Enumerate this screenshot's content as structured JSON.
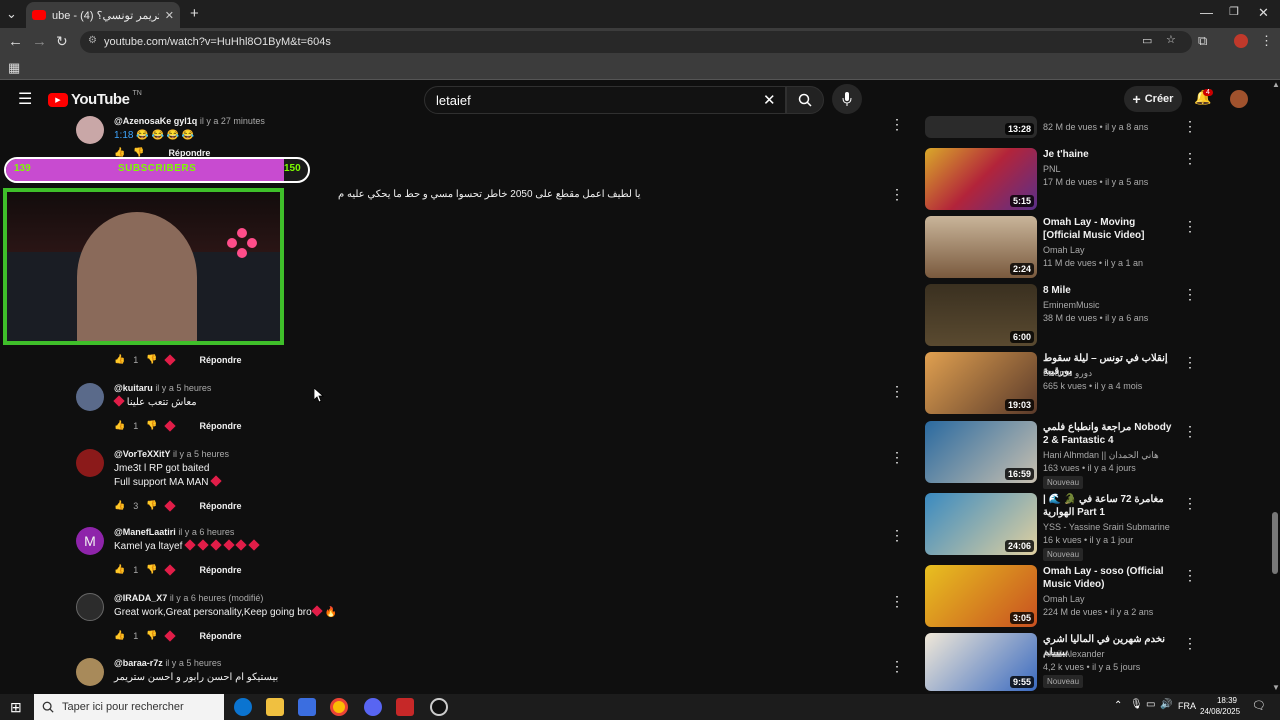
{
  "browser": {
    "tab_title": "ube - (4) أحسن ستريمر تونسي؟",
    "url": "youtube.com/watch?v=HuHhl8O1ByM&t=604s"
  },
  "header": {
    "logo": "YouTube",
    "region": "TN",
    "search_value": "letaief",
    "create_label": "Créer",
    "notif_count": "4"
  },
  "overlay": {
    "sub_left": "139",
    "sub_label": "SUBSCRIBERS",
    "sub_right": "150",
    "sub_progress": 0.92
  },
  "comments": {
    "reply_label": "Répondre",
    "items": [
      {
        "author": "@AzenosaKe gyl1q",
        "time": "il y a 27 minutes",
        "text": "1:18 😂 😂 😂 😂",
        "likes": ""
      },
      {
        "author": "",
        "time": "",
        "text": "يا لطيف اعمل مقطع على 2050 خاطر تحسوا مسي و حط ما يحكي عليه م",
        "likes": "1"
      },
      {
        "author": "@kuitaru",
        "time": "il y a 5 heures",
        "text": "معاش تتعب علينا",
        "likes": "1"
      },
      {
        "author": "@VorTeXXitY",
        "time": "il y a 5 heures",
        "text": "Jme3t l RP got baited",
        "text2": "Full support MA MAN",
        "likes": "3"
      },
      {
        "author": "@ManefLaatiri",
        "time": "il y a 6 heures",
        "text": "Kamel ya ltayef",
        "likes": "1"
      },
      {
        "author": "@IRADA_X7",
        "time": "il y a 6 heures (modifié)",
        "text": "Great work,Great personality,Keep going bro",
        "likes": "1"
      },
      {
        "author": "@baraa-r7z",
        "time": "il y a 5 heures",
        "text": "بيستيكو ام احسن رابور و احسن ستريمر",
        "likes": ""
      }
    ]
  },
  "sidebar": {
    "items": [
      {
        "title": "",
        "channel": "",
        "stats": "82 M de vues • il y a 8 ans",
        "duration": "13:28",
        "badge": ""
      },
      {
        "title": "Je t'haine",
        "channel": "PNL",
        "stats": "17 M de vues • il y a 5 ans",
        "duration": "5:15",
        "badge": ""
      },
      {
        "title": "Omah Lay - Moving [Official Music Video]",
        "channel": "Omah Lay",
        "stats": "11 M de vues • il y a 1 an",
        "duration": "2:24",
        "badge": ""
      },
      {
        "title": "8 Mile",
        "channel": "EminemMusic",
        "stats": "38 M de vues • il y a 6 ans",
        "duration": "6:00",
        "badge": ""
      },
      {
        "title": "إنقلاب في تونس – ليلة سقوط بورقيبة",
        "channel": "Dourou دورو",
        "stats": "665 k vues • il y a 4 mois",
        "duration": "19:03",
        "badge": ""
      },
      {
        "title": "مراجعة وانطباع فلمي Nobody 2 & Fantastic 4",
        "channel": "Hani Alhmdan || هاني الحمدان",
        "stats": "163 vues • il y a 4 jours",
        "duration": "16:59",
        "badge": "Nouveau"
      },
      {
        "title": "| 🌊 🐊 مغامرة 72 ساعة في الهوارية Part 1",
        "channel": "YSS - Yassine Srairi Submarine",
        "stats": "16 k vues • il y a 1 jour",
        "duration": "24:06",
        "badge": "Nouveau"
      },
      {
        "title": "Omah Lay -  soso (Official Music Video)",
        "channel": "Omah Lay",
        "stats": "224 M de vues • il y a 2 ans",
        "duration": "3:05",
        "badge": ""
      },
      {
        "title": "نخدم شهرين في الماليا اشري ببيييلم",
        "channel": "Aksil Alexander",
        "stats": "4,2 k vues • il y a 5 jours",
        "duration": "9:55",
        "badge": "Nouveau"
      }
    ]
  },
  "taskbar": {
    "search_placeholder": "Taper ici pour rechercher",
    "lang": "FRA",
    "time": "18:39",
    "date": "24/08/2025"
  }
}
